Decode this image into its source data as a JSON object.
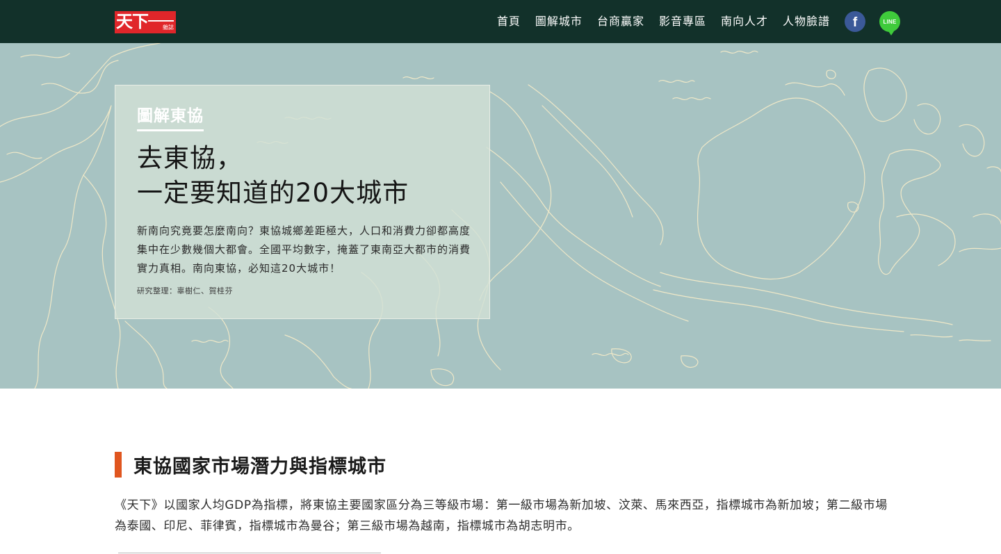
{
  "header": {
    "logo_text": "天下",
    "logo_sub": "雜誌",
    "nav": [
      "首頁",
      "圖解城市",
      "台商贏家",
      "影音專區",
      "南向人才",
      "人物臉譜"
    ],
    "social": {
      "facebook_label": "f",
      "line_label": "LINE"
    }
  },
  "hero": {
    "kicker": "圖解東協",
    "title_line1": "去東協，",
    "title_line2": "一定要知道的20大城市",
    "description": "新南向究竟要怎麼南向？東協城鄉差距極大，人口和消費力卻都高度集中在少數幾個大都會。全國平均數字，掩蓋了東南亞大都市的消費實力真相。南向東協，必知這20大城市！",
    "credit": "研究整理：辜樹仁、賀桂芬"
  },
  "section": {
    "title": "東協國家市場潛力與指標城市",
    "body": "《天下》以國家人均GDP為指標，將東協主要國家區分為三等級市場：第一級市場為新加坡、汶萊、馬來西亞，指標城市為新加坡；第二級市場為泰國、印尼、菲律賓，指標城市為曼谷；第三級市場為越南，指標城市為胡志明市。"
  },
  "colors": {
    "nav_bg": "#12312a",
    "hero_bg": "#a7c3c2",
    "map_line": "#efe8c8",
    "accent": "#e0561f",
    "logo_red": "#e0262a"
  }
}
